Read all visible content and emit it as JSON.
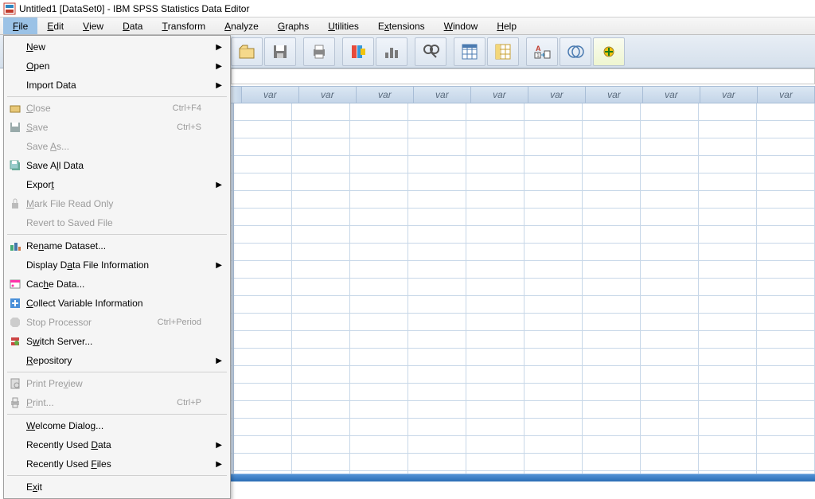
{
  "title": "Untitled1 [DataSet0] - IBM SPSS Statistics Data Editor",
  "menubar": [
    "File",
    "Edit",
    "View",
    "Data",
    "Transform",
    "Analyze",
    "Graphs",
    "Utilities",
    "Extensions",
    "Window",
    "Help"
  ],
  "menubar_underline_idx": [
    0,
    0,
    0,
    0,
    0,
    0,
    0,
    0,
    1,
    0,
    0
  ],
  "active_menu": "File",
  "file_menu": [
    {
      "type": "item",
      "label": "New",
      "underline": 0,
      "arrow": true,
      "enabled": true
    },
    {
      "type": "item",
      "label": "Open",
      "underline": 0,
      "arrow": true,
      "enabled": true
    },
    {
      "type": "item",
      "label": "Import Data",
      "arrow": true,
      "enabled": true
    },
    {
      "type": "sep"
    },
    {
      "type": "item",
      "label": "Close",
      "underline": 0,
      "shortcut": "Ctrl+F4",
      "enabled": false,
      "icon": "folder"
    },
    {
      "type": "item",
      "label": "Save",
      "underline": 0,
      "shortcut": "Ctrl+S",
      "enabled": false,
      "icon": "save"
    },
    {
      "type": "item",
      "label": "Save As...",
      "underline": 5,
      "enabled": false
    },
    {
      "type": "item",
      "label": "Save All Data",
      "underline": 6,
      "enabled": true,
      "icon": "save-all"
    },
    {
      "type": "item",
      "label": "Export",
      "underline": 5,
      "arrow": true,
      "enabled": true
    },
    {
      "type": "item",
      "label": "Mark File Read Only",
      "underline": 0,
      "enabled": false,
      "icon": "lock"
    },
    {
      "type": "item",
      "label": "Revert to Saved File",
      "enabled": false
    },
    {
      "type": "sep"
    },
    {
      "type": "item",
      "label": "Rename Dataset...",
      "underline": 2,
      "enabled": true,
      "icon": "rename"
    },
    {
      "type": "item",
      "label": "Display Data File Information",
      "underline": 9,
      "arrow": true,
      "enabled": true
    },
    {
      "type": "item",
      "label": "Cache Data...",
      "underline": 3,
      "enabled": true,
      "icon": "cache"
    },
    {
      "type": "item",
      "label": "Collect Variable Information",
      "underline": 0,
      "enabled": true,
      "icon": "collect"
    },
    {
      "type": "item",
      "label": "Stop Processor",
      "shortcut": "Ctrl+Period",
      "enabled": false,
      "icon": "stop"
    },
    {
      "type": "item",
      "label": "Switch Server...",
      "underline": 1,
      "enabled": true,
      "icon": "server"
    },
    {
      "type": "item",
      "label": "Repository",
      "underline": 0,
      "arrow": true,
      "enabled": true
    },
    {
      "type": "sep"
    },
    {
      "type": "item",
      "label": "Print Preview",
      "underline": 9,
      "enabled": false,
      "icon": "preview"
    },
    {
      "type": "item",
      "label": "Print...",
      "underline": 0,
      "shortcut": "Ctrl+P",
      "enabled": false,
      "icon": "print"
    },
    {
      "type": "sep"
    },
    {
      "type": "item",
      "label": "Welcome Dialog...",
      "underline": 0,
      "enabled": true
    },
    {
      "type": "item",
      "label": "Recently Used Data",
      "underline": 14,
      "arrow": true,
      "enabled": true
    },
    {
      "type": "item",
      "label": "Recently Used Files",
      "underline": 14,
      "arrow": true,
      "enabled": true
    },
    {
      "type": "sep"
    },
    {
      "type": "item",
      "label": "Exit",
      "underline": 1,
      "enabled": true
    }
  ],
  "col_header_label": "var",
  "visible_columns": 10,
  "visible_rows": 21,
  "toolbar_icons": [
    "open",
    "save",
    "print",
    "recall",
    "undo",
    "redo",
    "goto",
    "find",
    "split",
    "weight",
    "select",
    "value-labels",
    "use-sets",
    "show-all"
  ]
}
